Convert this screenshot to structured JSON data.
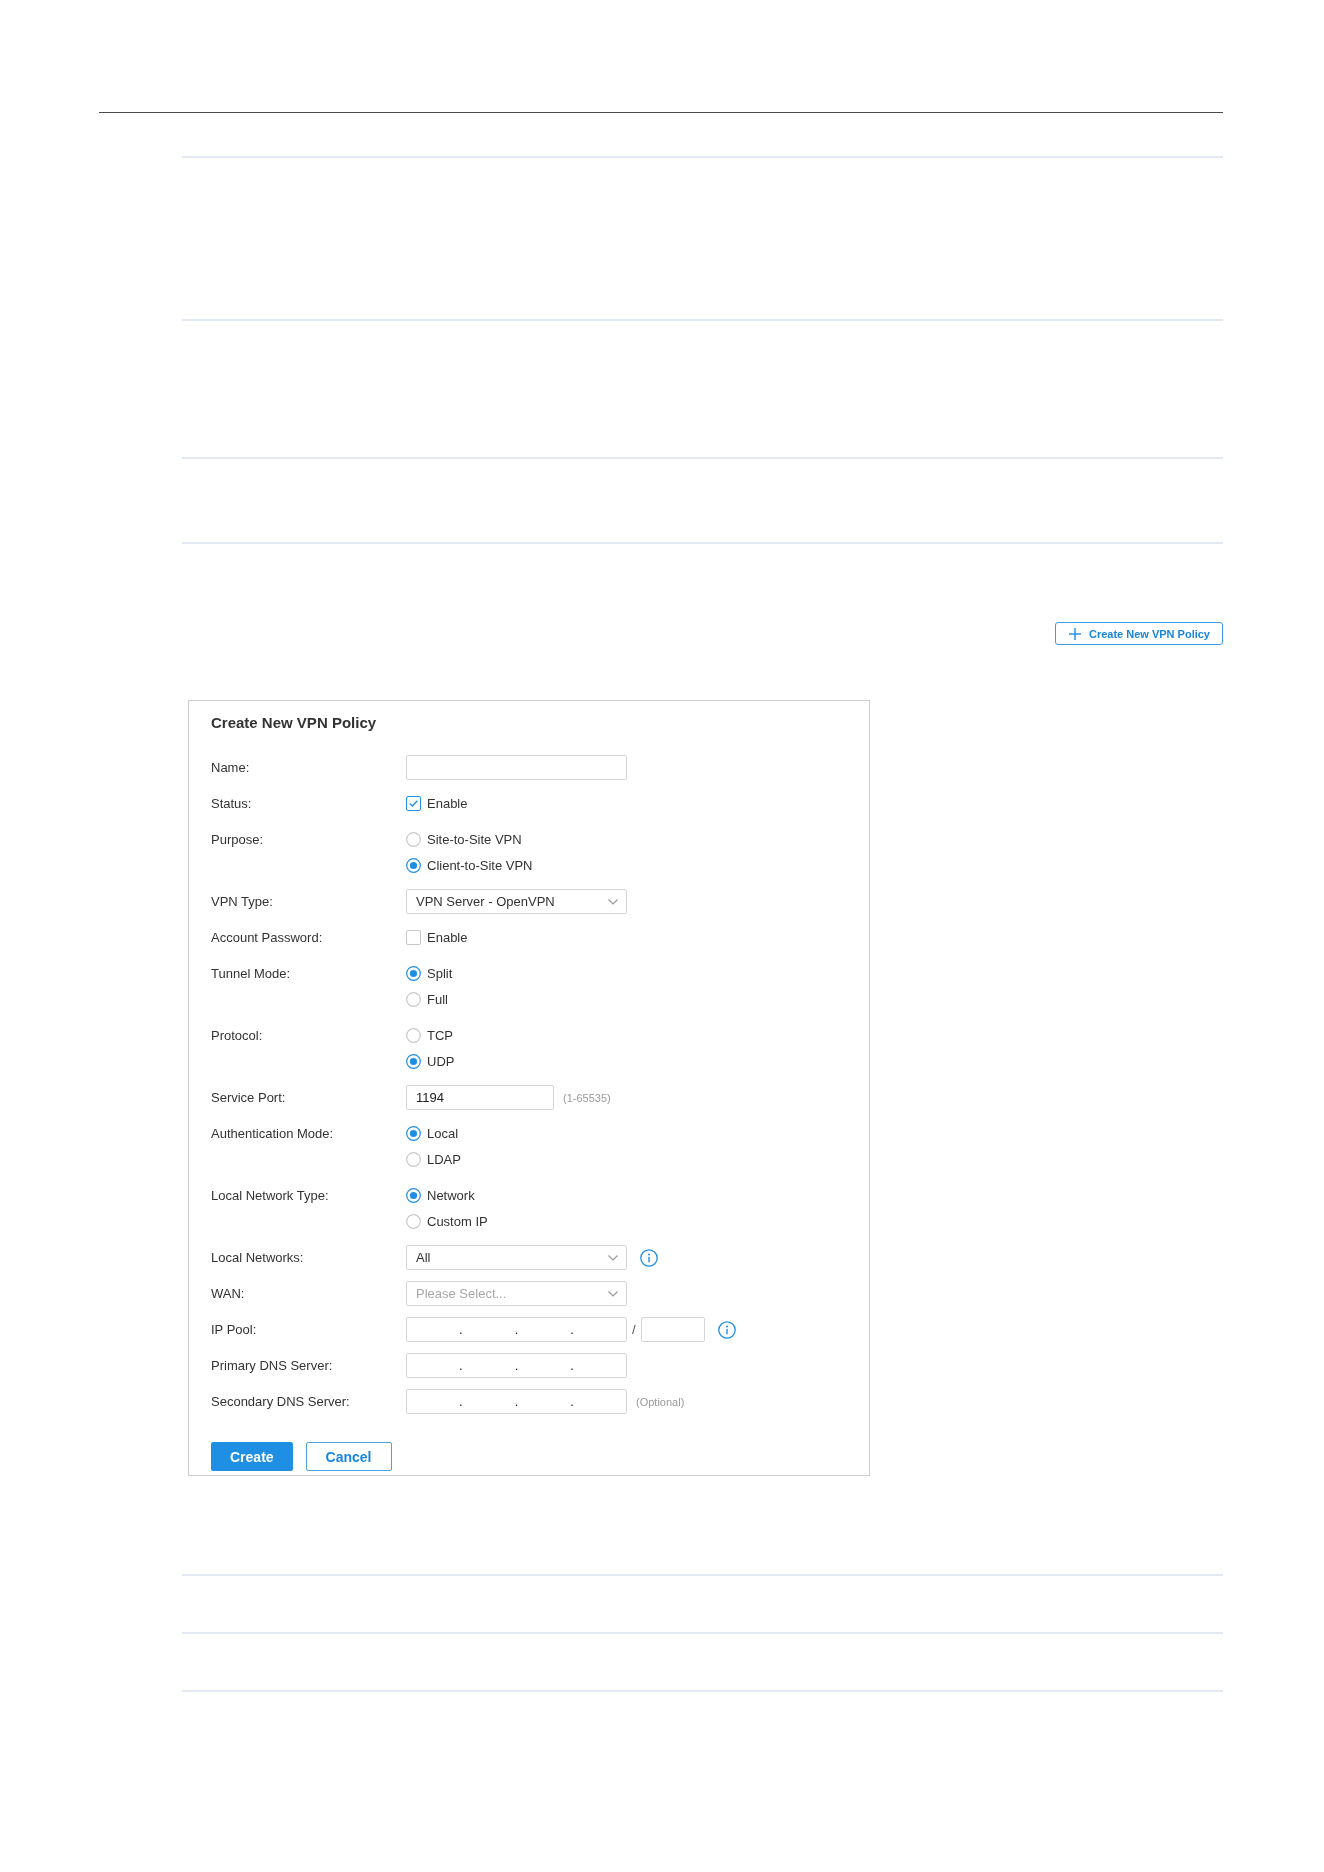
{
  "header_button": {
    "label": "Create New VPN Policy"
  },
  "form": {
    "title": "Create New VPN Policy",
    "fields": [
      {
        "kind": "text",
        "label": "Name:"
      },
      {
        "kind": "checkbox",
        "label": "Status:",
        "option": "Enable",
        "checked": true
      },
      {
        "kind": "radio",
        "label": "Purpose:",
        "options": [
          {
            "label": "Site-to-Site VPN",
            "selected": false
          },
          {
            "label": "Client-to-Site VPN",
            "selected": true
          }
        ]
      },
      {
        "kind": "select",
        "label": "VPN Type:",
        "value": "VPN Server - OpenVPN"
      },
      {
        "kind": "checkbox",
        "label": "Account Password:",
        "option": "Enable",
        "checked": false
      },
      {
        "kind": "radio",
        "label": "Tunnel Mode:",
        "options": [
          {
            "label": "Split",
            "selected": true
          },
          {
            "label": "Full",
            "selected": false
          }
        ]
      },
      {
        "kind": "radio",
        "label": "Protocol:",
        "options": [
          {
            "label": "TCP",
            "selected": false
          },
          {
            "label": "UDP",
            "selected": true
          }
        ]
      },
      {
        "kind": "number",
        "label": "Service Port:",
        "value": "1194",
        "hint": "(1-65535)"
      },
      {
        "kind": "radio",
        "label": "Authentication Mode:",
        "options": [
          {
            "label": "Local",
            "selected": true
          },
          {
            "label": "LDAP",
            "selected": false
          }
        ]
      },
      {
        "kind": "radio",
        "label": "Local Network Type:",
        "options": [
          {
            "label": "Network",
            "selected": true
          },
          {
            "label": "Custom IP",
            "selected": false
          }
        ]
      },
      {
        "kind": "select",
        "label": "Local Networks:",
        "value": "All",
        "info": true
      },
      {
        "kind": "select",
        "label": "WAN:",
        "placeholder": "Please Select..."
      },
      {
        "kind": "ip",
        "label": "IP Pool:",
        "separators": [
          ".",
          ".",
          "."
        ],
        "mask_separator": "/",
        "info": true
      },
      {
        "kind": "ip",
        "label": "Primary DNS Server:",
        "separators": [
          ".",
          ".",
          "."
        ]
      },
      {
        "kind": "ip",
        "label": "Secondary DNS Server:",
        "separators": [
          ".",
          ".",
          "."
        ],
        "hint": "(Optional)"
      }
    ],
    "buttons": [
      {
        "kind": "primary",
        "label": "Create"
      },
      {
        "kind": "secondary",
        "label": "Cancel"
      }
    ]
  }
}
